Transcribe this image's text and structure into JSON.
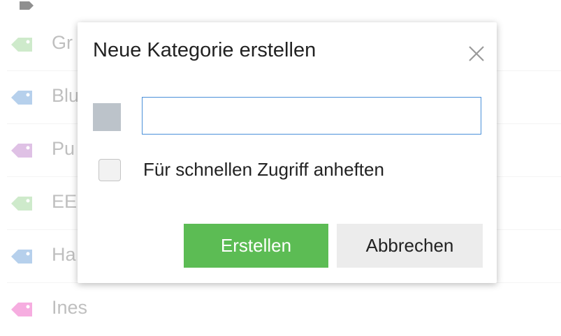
{
  "background_list": {
    "items": [
      {
        "label": "Gr",
        "color": "#a7d9a1"
      },
      {
        "label": "Blu",
        "color": "#7aa9dc"
      },
      {
        "label": "Pu",
        "color": "#c58fd0"
      },
      {
        "label": "EE",
        "color": "#a7d9a1"
      },
      {
        "label": "Ha",
        "color": "#7aa9dc"
      },
      {
        "label": "Ines",
        "color": "#ef6bc7"
      }
    ]
  },
  "dialog": {
    "title": "Neue Kategorie erstellen",
    "close_icon": "close-icon",
    "color_swatch": "#bcc3ca",
    "name_input_value": "",
    "pin_checkbox_label": "Für schnellen Zugriff anheften",
    "pin_checked": false,
    "create_label": "Erstellen",
    "cancel_label": "Abbrechen",
    "colors": {
      "primary": "#5cbc54",
      "input_border": "#4a90d9",
      "secondary_bg": "#ececec"
    }
  }
}
